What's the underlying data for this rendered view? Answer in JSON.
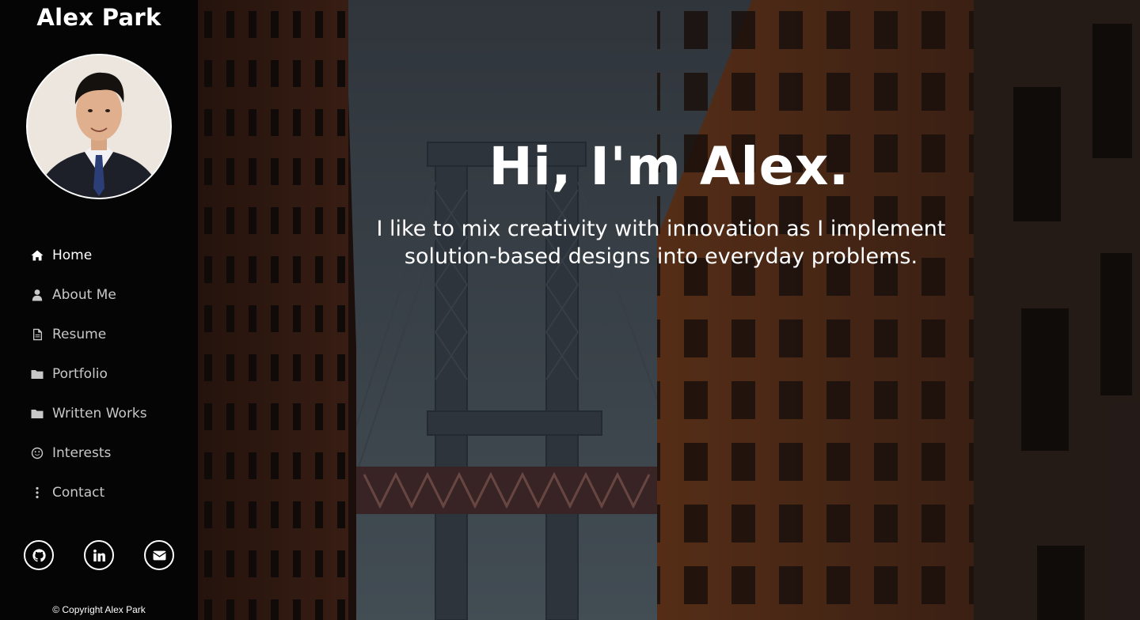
{
  "sidebar": {
    "title": "Alex Park",
    "avatar_alt": "Profile photo",
    "nav": [
      {
        "label": "Home",
        "icon": "home-icon",
        "active": true
      },
      {
        "label": "About Me",
        "icon": "user-icon"
      },
      {
        "label": "Resume",
        "icon": "document-icon"
      },
      {
        "label": "Portfolio",
        "icon": "folder-icon"
      },
      {
        "label": "Written Works",
        "icon": "folder-icon"
      },
      {
        "label": "Interests",
        "icon": "smile-icon"
      },
      {
        "label": "Contact",
        "icon": "vertical-dots-icon"
      }
    ],
    "social": [
      {
        "name": "github-icon"
      },
      {
        "name": "linkedin-icon"
      },
      {
        "name": "envelope-icon"
      }
    ],
    "copyright": "© Copyright Alex Park"
  },
  "hero": {
    "title": "Hi, I'm Alex.",
    "subtitle": "I like to mix creativity with innovation as I implement solution-based designs into everyday problems."
  },
  "colors": {
    "sidebar_bg": "#050505",
    "nav_active": "#ffffff",
    "nav_inactive": "#c8c8c8",
    "hero_overlay": "rgba(0,0,0,0.38)"
  }
}
